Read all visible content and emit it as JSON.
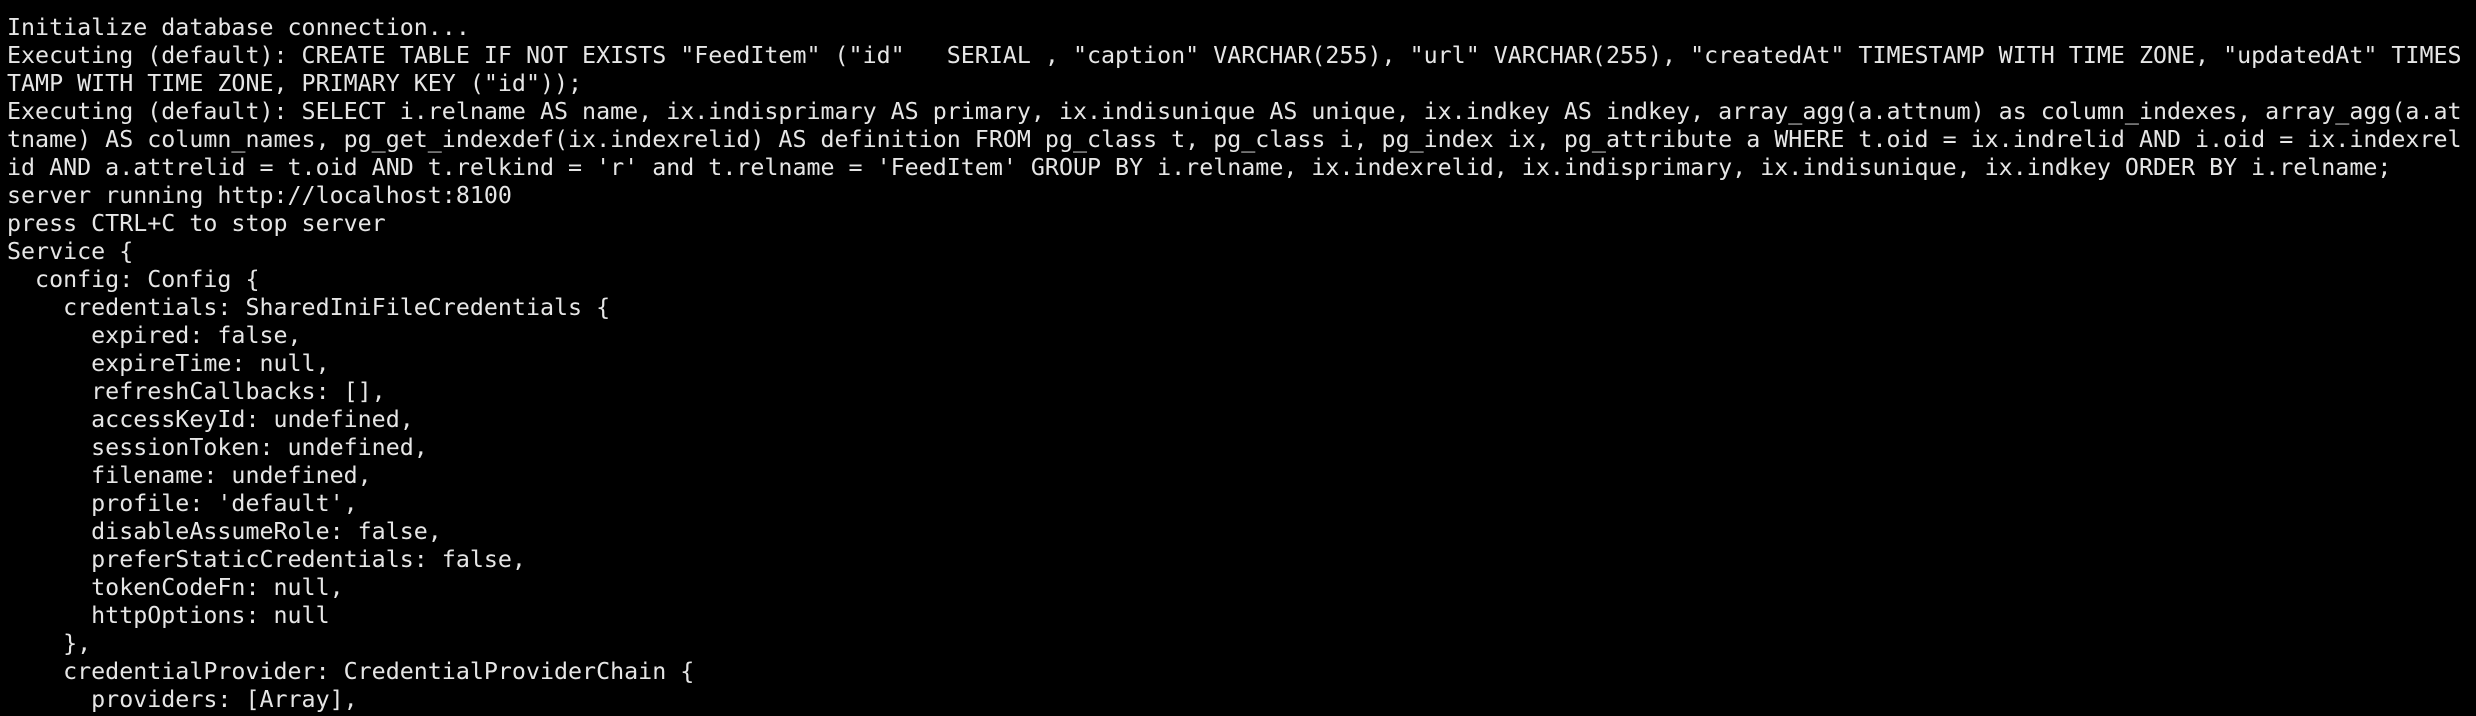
{
  "colors": {
    "background": "#000000",
    "foreground": "#e6e6e6"
  },
  "terminal": {
    "lines": [
      "Initialize database connection...",
      "Executing (default): CREATE TABLE IF NOT EXISTS \"FeedItem\" (\"id\"   SERIAL , \"caption\" VARCHAR(255), \"url\" VARCHAR(255), \"createdAt\" TIMESTAMP WITH TIME ZONE, \"updatedAt\" TIMES",
      "TAMP WITH TIME ZONE, PRIMARY KEY (\"id\"));",
      "Executing (default): SELECT i.relname AS name, ix.indisprimary AS primary, ix.indisunique AS unique, ix.indkey AS indkey, array_agg(a.attnum) as column_indexes, array_agg(a.at",
      "tname) AS column_names, pg_get_indexdef(ix.indexrelid) AS definition FROM pg_class t, pg_class i, pg_index ix, pg_attribute a WHERE t.oid = ix.indrelid AND i.oid = ix.indexrel",
      "id AND a.attrelid = t.oid AND t.relkind = 'r' and t.relname = 'FeedItem' GROUP BY i.relname, ix.indexrelid, ix.indisprimary, ix.indisunique, ix.indkey ORDER BY i.relname;",
      "server running http://localhost:8100",
      "press CTRL+C to stop server",
      "Service {",
      "  config: Config {",
      "    credentials: SharedIniFileCredentials {",
      "      expired: false,",
      "      expireTime: null,",
      "      refreshCallbacks: [],",
      "      accessKeyId: undefined,",
      "      sessionToken: undefined,",
      "      filename: undefined,",
      "      profile: 'default',",
      "      disableAssumeRole: false,",
      "      preferStaticCredentials: false,",
      "      tokenCodeFn: null,",
      "      httpOptions: null",
      "    },",
      "    credentialProvider: CredentialProviderChain {",
      "      providers: [Array],"
    ]
  }
}
